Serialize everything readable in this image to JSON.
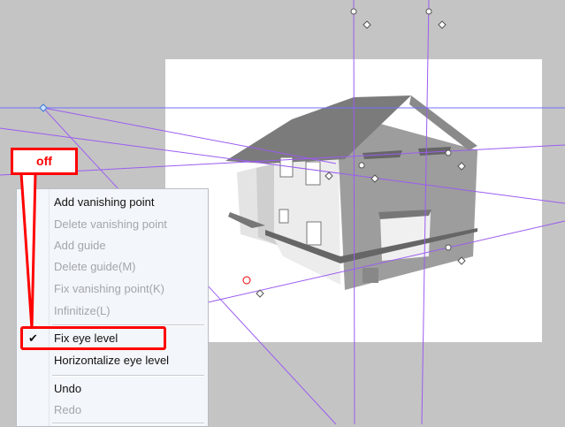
{
  "callout": {
    "label": "off",
    "color": "#ff0000"
  },
  "guide_color": "#9b5cf0",
  "context_menu": {
    "items": [
      {
        "label": "Add vanishing point",
        "enabled": true
      },
      {
        "label": "Delete vanishing point",
        "enabled": false
      },
      {
        "label": "Add guide",
        "enabled": false
      },
      {
        "label": "Delete guide(M)",
        "enabled": false
      },
      {
        "label": "Fix vanishing point(K)",
        "enabled": false
      },
      {
        "label": "Infinitize(L)",
        "enabled": false
      },
      {
        "label": "Fix eye level",
        "enabled": true,
        "checked": true
      },
      {
        "label": "Horizontalize eye level",
        "enabled": true
      },
      {
        "label": "Undo",
        "enabled": true
      },
      {
        "label": "Redo",
        "enabled": false
      }
    ],
    "check_glyph": "✔"
  }
}
